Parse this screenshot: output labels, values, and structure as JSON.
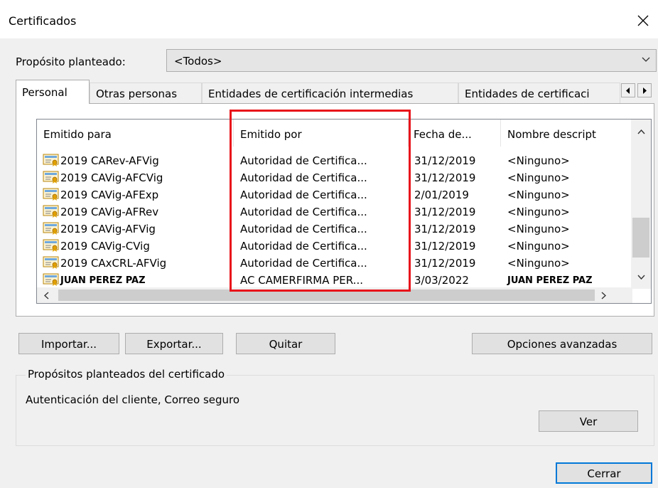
{
  "window": {
    "title": "Certificados"
  },
  "purpose": {
    "label": "Propósito planteado:",
    "selected": "<Todos>"
  },
  "tabs": [
    {
      "label": "Personal"
    },
    {
      "label": "Otras personas"
    },
    {
      "label": "Entidades de certificación intermedias"
    },
    {
      "label": "Entidades de certificaci"
    }
  ],
  "list": {
    "columns": [
      "Emitido para",
      "Emitido por",
      "Fecha de...",
      "Nombre descript"
    ],
    "rows": [
      {
        "issued_to": "2019 CARev-AFVig",
        "issued_by": "Autoridad de Certifica...",
        "date": "31/12/2019",
        "name": "<Ninguno>"
      },
      {
        "issued_to": "2019 CAVig-AFCVig",
        "issued_by": "Autoridad de Certifica...",
        "date": "31/12/2019",
        "name": "<Ninguno>"
      },
      {
        "issued_to": "2019 CAVig-AFExp",
        "issued_by": "Autoridad de Certifica...",
        "date": "2/01/2019",
        "name": "<Ninguno>"
      },
      {
        "issued_to": "2019 CAVig-AFRev",
        "issued_by": "Autoridad de Certifica...",
        "date": "31/12/2019",
        "name": "<Ninguno>"
      },
      {
        "issued_to": "2019 CAVig-AFVig",
        "issued_by": "Autoridad de Certifica...",
        "date": "31/12/2019",
        "name": "<Ninguno>"
      },
      {
        "issued_to": "2019 CAVig-CVig",
        "issued_by": "Autoridad de Certifica...",
        "date": "31/12/2019",
        "name": "<Ninguno>"
      },
      {
        "issued_to": "2019 CAxCRL-AFVig",
        "issued_by": "Autoridad de Certifica...",
        "date": "31/12/2019",
        "name": "<Ninguno>"
      },
      {
        "issued_to": "JUAN PEREZ PAZ",
        "issued_by": "AC CAMERFIRMA PER...",
        "date": "3/03/2022",
        "name": "JUAN PEREZ PAZ"
      }
    ]
  },
  "buttons": {
    "import": "Importar...",
    "export": "Exportar...",
    "remove": "Quitar",
    "advanced": "Opciones avanzadas",
    "view": "Ver",
    "close": "Cerrar"
  },
  "purposes_group": {
    "title": "Propósitos planteados del certificado",
    "text": "Autenticación del cliente, Correo seguro"
  },
  "colors": {
    "highlight": "#e8141b",
    "focus_border": "#0078d7"
  }
}
